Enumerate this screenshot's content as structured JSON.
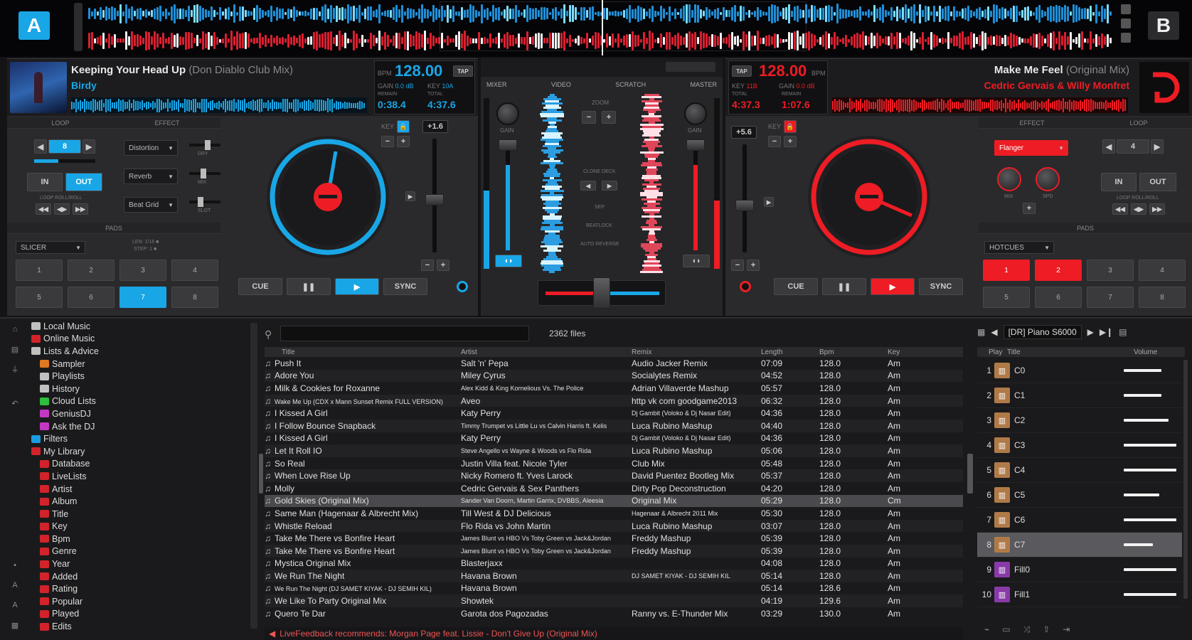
{
  "decks": {
    "a": {
      "badge": "A",
      "title": "Keeping Your Head Up",
      "remix": "(Don Diablo Club Mix)",
      "artist": "Birdy",
      "bpm": "128.00",
      "bpm_label": "BPM",
      "tap": "TAP",
      "gain_label": "GAIN",
      "gain_val": "0.0 dB",
      "key_label": "KEY",
      "key_val": "10A",
      "elapsed": "0:38.4",
      "remain": "4:37.6",
      "elapsed_label": "REMAIN",
      "total_label": "TOTAL",
      "pitch": "+1.6",
      "loop_section": "LOOP",
      "effect_section": "EFFECT",
      "pads_section": "PADS",
      "loop_val": "8",
      "in_label": "IN",
      "out_label": "OUT",
      "loop_roll": "LOOP ROLL/ROLL",
      "effects": [
        "Distortion",
        "Reverb",
        "Beat Grid"
      ],
      "fx_knob_labels": [
        "DRY",
        "MIX",
        "SLOT"
      ],
      "pad_mode": "SLICER",
      "pad_info": [
        "LEN: 1/16 ■",
        "STEP: 1 ■"
      ],
      "pads": [
        "1",
        "2",
        "3",
        "4",
        "5",
        "6",
        "7",
        "8"
      ],
      "transport": [
        "CUE",
        "❚❚",
        "▶",
        "SYNC"
      ],
      "accent": "#19a6e6"
    },
    "b": {
      "badge": "B",
      "title": "Make Me Feel",
      "remix": "(Original Mix)",
      "artist": "Cedric Gervais & Willy Monfret",
      "bpm": "128.00",
      "bpm_label": "BPM",
      "tap": "TAP",
      "key_label": "KEY",
      "key_val": "11B",
      "gain_label": "GAIN",
      "gain_val": "0.0 dB",
      "elapsed": "4:37.3",
      "remain": "1:07.6",
      "elapsed_label": "TOTAL",
      "total_label": "REMAIN",
      "pitch": "+5.6",
      "loop_section": "LOOP",
      "effect_section": "EFFECT",
      "pads_section": "PADS",
      "loop_val": "4",
      "in_label": "IN",
      "out_label": "OUT",
      "loop_roll": "LOOP ROLL/ROLL",
      "effect": "Flanger",
      "fx_knob_labels": [
        "MIX",
        "SPD"
      ],
      "pad_mode": "HOTCUES",
      "pads": [
        "1",
        "2",
        "3",
        "4",
        "5",
        "6",
        "7",
        "8"
      ],
      "transport": [
        "CUE",
        "❚❚",
        "▶",
        "SYNC"
      ],
      "accent": "#ee1c24"
    }
  },
  "mixer": {
    "tabs": [
      "MIXER",
      "VIDEO",
      "SCRATCH",
      "MASTER"
    ],
    "gain_label": "GAIN",
    "zoom_label": "ZOOM",
    "clone_label": "CLONE DECK",
    "sep_labels": [
      "SEP",
      "BEATLOCK",
      "AUTO REVERSE"
    ]
  },
  "browser": {
    "file_count": "2362 files",
    "tree": [
      {
        "label": "Local Music",
        "color": "#c0c0c0",
        "indent": 0
      },
      {
        "label": "Online Music",
        "color": "#d2232a",
        "indent": 0
      },
      {
        "label": "Lists & Advice",
        "color": "#c0c0c0",
        "indent": 0
      },
      {
        "label": "Sampler",
        "color": "#e07820",
        "indent": 1
      },
      {
        "label": "Playlists",
        "color": "#c0c0c0",
        "indent": 1
      },
      {
        "label": "History",
        "color": "#c0c0c0",
        "indent": 1
      },
      {
        "label": "Cloud Lists",
        "color": "#2ebd3c",
        "indent": 1
      },
      {
        "label": "GeniusDJ",
        "color": "#c238c2",
        "indent": 1
      },
      {
        "label": "Ask the DJ",
        "color": "#c238c2",
        "indent": 1
      },
      {
        "label": "Filters",
        "color": "#1c9be0",
        "indent": 0
      },
      {
        "label": "My Library",
        "color": "#d2232a",
        "indent": 0
      },
      {
        "label": "Database",
        "color": "#d2232a",
        "indent": 1
      },
      {
        "label": "LiveLists",
        "color": "#d2232a",
        "indent": 1
      },
      {
        "label": "Artist",
        "color": "#d2232a",
        "indent": 1
      },
      {
        "label": "Album",
        "color": "#d2232a",
        "indent": 1
      },
      {
        "label": "Title",
        "color": "#d2232a",
        "indent": 1
      },
      {
        "label": "Key",
        "color": "#d2232a",
        "indent": 1
      },
      {
        "label": "Bpm",
        "color": "#d2232a",
        "indent": 1
      },
      {
        "label": "Genre",
        "color": "#d2232a",
        "indent": 1
      },
      {
        "label": "Year",
        "color": "#d2232a",
        "indent": 1
      },
      {
        "label": "Added",
        "color": "#d2232a",
        "indent": 1
      },
      {
        "label": "Rating",
        "color": "#d2232a",
        "indent": 1
      },
      {
        "label": "Popular",
        "color": "#d2232a",
        "indent": 1
      },
      {
        "label": "Played",
        "color": "#d2232a",
        "indent": 1
      },
      {
        "label": "Edits",
        "color": "#d2232a",
        "indent": 1
      }
    ],
    "columns": [
      "Title",
      "Artist",
      "Remix",
      "Length",
      "Bpm",
      "Key"
    ],
    "rows": [
      [
        "Push It",
        "Salt 'n' Pepa",
        "Audio Jacker Remix",
        "07:09",
        "128.0",
        "Am"
      ],
      [
        "Adore You",
        "Miley Cyrus",
        "Socialytes Remix",
        "04:52",
        "128.0",
        "Am"
      ],
      [
        "Milk & Cookies for Roxanne",
        "Alex Kidd & King Kornelious Vs. The Police",
        "Adrian Villaverde Mashup",
        "05:57",
        "128.0",
        "Am"
      ],
      [
        "Wake Me Up (CDX x Mann Sunset Remix FULL VERSION)",
        "Aveo",
        "http vk com goodgame2013",
        "06:32",
        "128.0",
        "Am"
      ],
      [
        "I Kissed A Girl",
        "Katy Perry",
        "Dj Gambit (Voloko & Dj Nasar Edit)",
        "04:36",
        "128.0",
        "Am"
      ],
      [
        "I Follow Bounce Snapback",
        "Timmy Trumpet vs Little Lu vs Calvin Harris ft. Kelis",
        "Luca Rubino Mashup",
        "04:40",
        "128.0",
        "Am"
      ],
      [
        "I Kissed A Girl",
        "Katy Perry",
        "Dj Gambit (Voloko & Dj Nasar Edit)",
        "04:36",
        "128.0",
        "Am"
      ],
      [
        "Let It Roll IO",
        "Steve Angello vs Wayne & Woods vs Flo Rida",
        "Luca Rubino Mashup",
        "05:06",
        "128.0",
        "Am"
      ],
      [
        "So Real",
        "Justin Villa feat. Nicole Tyler",
        "Club Mix",
        "05:48",
        "128.0",
        "Am"
      ],
      [
        "When Love Rise Up",
        "Nicky Romero ft. Yves Larock",
        "David Puentez Bootleg Mix",
        "05:37",
        "128.0",
        "Am"
      ],
      [
        "Molly",
        "Cedric Gervais & Sex Panthers",
        "Dirty Pop Deconstruction",
        "04:20",
        "128.0",
        "Am"
      ],
      [
        "Gold Skies (Original Mix)",
        "Sander Van Doorn, Martin Garrix, DVBBS, Aleesia",
        "Original Mix",
        "05:29",
        "128.0",
        "Cm"
      ],
      [
        "Same Man (Hagenaar & Albrecht Mix)",
        "Till West & DJ Delicious",
        "Hagenaar & Albrecht 2011 Mix",
        "05:30",
        "128.0",
        "Am"
      ],
      [
        "Whistle Reload",
        "Flo Rida vs John Martin",
        "Luca Rubino Mashup",
        "03:07",
        "128.0",
        "Am"
      ],
      [
        "Take Me There vs Bonfire Heart",
        "James Blunt vs HBO Vs Toby Green vs Jack&Jordan",
        "Freddy Mashup",
        "05:39",
        "128.0",
        "Am"
      ],
      [
        "Take Me There vs Bonfire Heart",
        "James Blunt vs HBO Vs Toby Green vs Jack&Jordan",
        "Freddy Mashup",
        "05:39",
        "128.0",
        "Am"
      ],
      [
        "Mystica Original Mix",
        "Blasterjaxx",
        "",
        "04:08",
        "128.0",
        "Am"
      ],
      [
        "We Run The Night",
        "Havana Brown",
        "DJ SAMET KIYAK - DJ SEMIH KIL",
        "05:14",
        "128.0",
        "Am"
      ],
      [
        "We Run The Night (DJ SAMET KIYAK - DJ SEMIH KIL)",
        "Havana Brown",
        "",
        "05:14",
        "128.6",
        "Am"
      ],
      [
        "We Like To Party Original Mix",
        "Showtek",
        "",
        "04:19",
        "129.6",
        "Am"
      ],
      [
        "Quero Te Dar",
        "Garota dos Pagozadas",
        "Ranny vs. E-Thunder Mix",
        "03:29",
        "130.0",
        "Am"
      ]
    ],
    "feedback": "LiveFeedback recommends: Morgan Page feat. Lissie - Don't Give Up (Original Mix)",
    "sampler": {
      "bank": "[DR] Piano S6000",
      "col_play": "Play",
      "col_title": "Title",
      "col_volume": "Volume",
      "items": [
        {
          "num": "1",
          "title": "C0",
          "volume": 0.72
        },
        {
          "num": "2",
          "title": "C1",
          "volume": 0.72
        },
        {
          "num": "3",
          "title": "C2",
          "volume": 0.85
        },
        {
          "num": "4",
          "title": "C3",
          "volume": 1.0
        },
        {
          "num": "5",
          "title": "C4",
          "volume": 1.0
        },
        {
          "num": "6",
          "title": "C5",
          "volume": 0.68
        },
        {
          "num": "7",
          "title": "C6",
          "volume": 1.0
        },
        {
          "num": "8",
          "title": "C7",
          "volume": 0.55
        },
        {
          "num": "9",
          "title": "Fill0",
          "volume": 1.0
        },
        {
          "num": "10",
          "title": "Fill1",
          "volume": 1.0
        }
      ]
    }
  }
}
